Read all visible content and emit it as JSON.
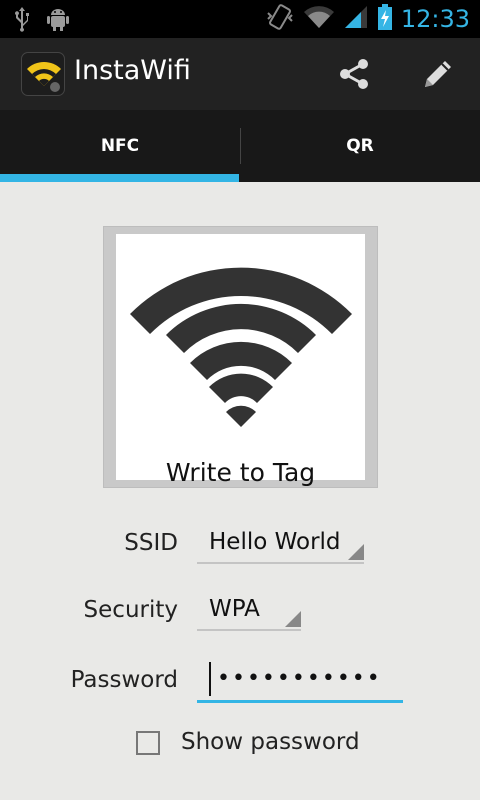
{
  "status_bar": {
    "time": "12:33",
    "icons": [
      "usb-icon",
      "android-debug-icon",
      "vibrate-icon",
      "wifi-signal-icon",
      "cell-signal-icon",
      "battery-charging-icon"
    ]
  },
  "action_bar": {
    "title": "InstaWifi",
    "actions": [
      "share-icon",
      "edit-icon"
    ]
  },
  "tabs": [
    {
      "label": "NFC",
      "selected": true
    },
    {
      "label": "QR",
      "selected": false
    }
  ],
  "write_tag": {
    "label": "Write to Tag"
  },
  "form": {
    "ssid_label": "SSID",
    "ssid_value": "Hello World",
    "security_label": "Security",
    "security_value": "WPA",
    "password_label": "Password",
    "password_value": "•••••••••••",
    "show_password_label": "Show password",
    "show_password_checked": false
  },
  "colors": {
    "accent": "#33b5e5",
    "action_bar": "#222222",
    "background": "#e9e9e7"
  }
}
